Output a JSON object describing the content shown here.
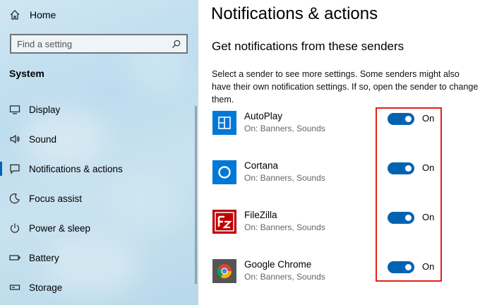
{
  "sidebar": {
    "home_label": "Home",
    "search": {
      "placeholder": "Find a setting",
      "value": ""
    },
    "section_title": "System",
    "items": [
      {
        "label": "Display",
        "icon": "monitor-icon"
      },
      {
        "label": "Sound",
        "icon": "speaker-icon"
      },
      {
        "label": "Notifications & actions",
        "icon": "notification-icon",
        "active": true
      },
      {
        "label": "Focus assist",
        "icon": "moon-icon"
      },
      {
        "label": "Power & sleep",
        "icon": "power-icon"
      },
      {
        "label": "Battery",
        "icon": "battery-icon"
      },
      {
        "label": "Storage",
        "icon": "storage-icon"
      }
    ]
  },
  "main": {
    "title": "Notifications & actions",
    "subtitle": "Get notifications from these senders",
    "description": "Select a sender to see more settings. Some senders might also have their own notification settings. If so, open the sender to change them.",
    "senders": [
      {
        "name": "AutoPlay",
        "status": "On: Banners, Sounds",
        "toggle_label": "On",
        "icon": "autoplay-icon"
      },
      {
        "name": "Cortana",
        "status": "On: Banners, Sounds",
        "toggle_label": "On",
        "icon": "cortana-icon"
      },
      {
        "name": "FileZilla",
        "status": "On: Banners, Sounds",
        "toggle_label": "On",
        "icon": "filezilla-icon"
      },
      {
        "name": "Google Chrome",
        "status": "On: Banners, Sounds",
        "toggle_label": "On",
        "icon": "chrome-icon"
      }
    ]
  },
  "colors": {
    "accent": "#0063b1",
    "highlight": "#e0231a",
    "filezilla_red": "#bf0000"
  }
}
